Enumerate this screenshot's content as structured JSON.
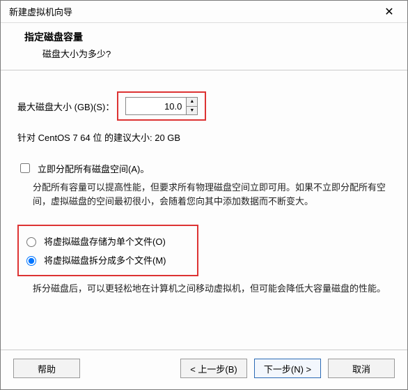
{
  "window": {
    "title": "新建虚拟机向导"
  },
  "header": {
    "title": "指定磁盘容量",
    "subtitle": "磁盘大小为多少?"
  },
  "size": {
    "label": "最大磁盘大小 (GB)(S)：",
    "value": "10.0",
    "recommend": "针对 CentOS 7 64 位 的建议大小: 20 GB"
  },
  "allocate": {
    "label": "立即分配所有磁盘空间(A)。",
    "checked": false,
    "desc": "分配所有容量可以提高性能，但要求所有物理磁盘空间立即可用。如果不立即分配所有空间，虚拟磁盘的空间最初很小，会随着您向其中添加数据而不断变大。"
  },
  "storage": {
    "single_label": "将虚拟磁盘存储为单个文件(O)",
    "split_label": "将虚拟磁盘拆分成多个文件(M)",
    "selected": "split",
    "split_desc": "拆分磁盘后，可以更轻松地在计算机之间移动虚拟机，但可能会降低大容量磁盘的性能。"
  },
  "buttons": {
    "help": "帮助",
    "back": "< 上一步(B)",
    "next": "下一步(N) >",
    "cancel": "取消"
  }
}
